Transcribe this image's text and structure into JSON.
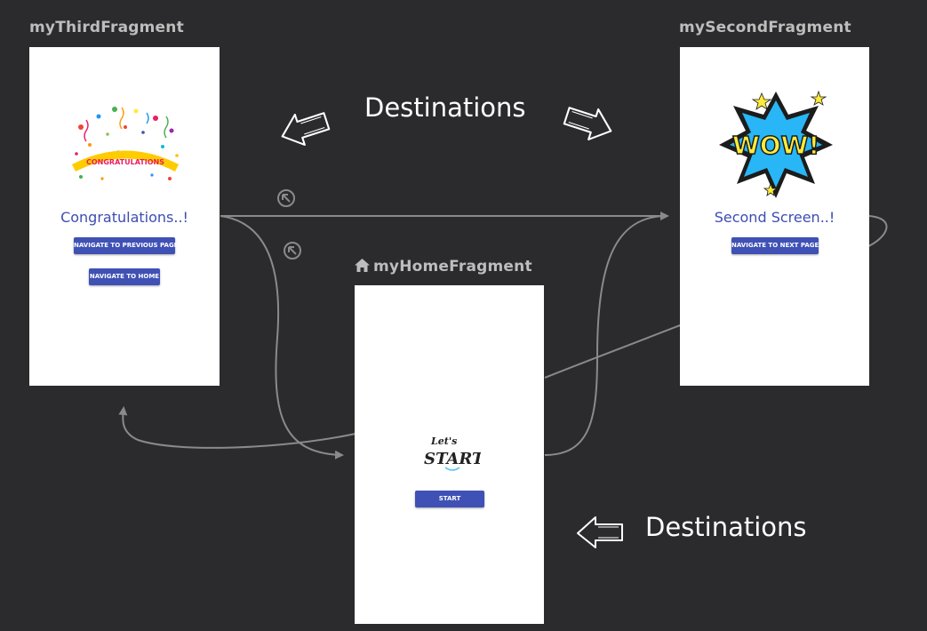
{
  "fragments": {
    "third": {
      "title": "myThirdFragment",
      "heading": "Congratulations..!",
      "buttons": [
        "NAVIGATE TO PREVIOUS PAGE",
        "NAVIGATE TO HOME"
      ],
      "image_text": "CONGRATULATIONS"
    },
    "second": {
      "title": "mySecondFragment",
      "heading": "Second Screen..!",
      "buttons": [
        "NAVIGATE TO NEXT PAGE"
      ],
      "image_text": "WOW!"
    },
    "home": {
      "title": "myHomeFragment",
      "buttons": [
        "START"
      ],
      "image_text": [
        "Let's",
        "START"
      ]
    }
  },
  "callouts": [
    "Destinations",
    "Destinations"
  ],
  "icons": {
    "start_destination": "home-icon",
    "pop_behavior": "arrow-up-left-circle-icon",
    "pointer": "hand-drawn-arrow-icon"
  },
  "colors": {
    "background": "#2b2b2d",
    "button": "#3f51b5",
    "heading_text": "#3d4db3",
    "connector": "#8a8a8a"
  }
}
